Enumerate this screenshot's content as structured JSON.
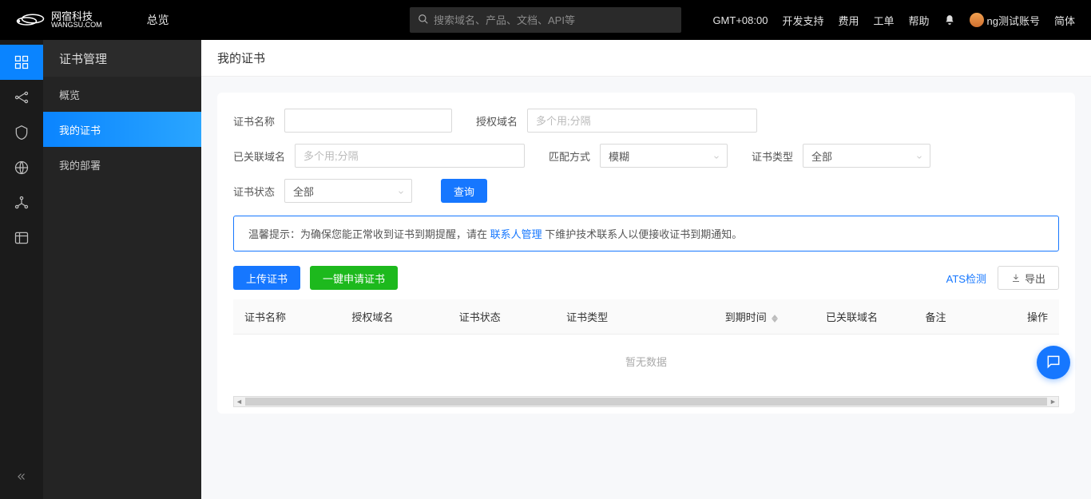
{
  "brand": {
    "cn": "网宿科技",
    "en": "WANGSU.COM"
  },
  "topbar": {
    "overview": "总览",
    "search_placeholder": "搜索域名、产品、文档、API等",
    "timezone": "GMT+08:00",
    "dev_support": "开发支持",
    "billing": "费用",
    "tickets": "工单",
    "help": "帮助",
    "account": "ng测试账号",
    "lang": "简体"
  },
  "sidebar": {
    "title": "证书管理",
    "items": [
      {
        "label": "概览"
      },
      {
        "label": "我的证书"
      },
      {
        "label": "我的部署"
      }
    ]
  },
  "page": {
    "title": "我的证书"
  },
  "filters": {
    "cert_name_label": "证书名称",
    "auth_domain_label": "授权域名",
    "auth_domain_placeholder": "多个用;分隔",
    "linked_domain_label": "已关联域名",
    "linked_domain_placeholder": "多个用;分隔",
    "match_mode_label": "匹配方式",
    "match_mode_value": "模糊",
    "cert_type_label": "证书类型",
    "cert_type_value": "全部",
    "cert_status_label": "证书状态",
    "cert_status_value": "全部",
    "query_btn": "查询"
  },
  "notice": {
    "prefix": "温馨提示：为确保您能正常收到证书到期提醒，请在 ",
    "link": "联系人管理",
    "suffix": " 下维护技术联系人以便接收证书到期通知。"
  },
  "actions": {
    "upload": "上传证书",
    "quick_apply": "一键申请证书",
    "ats": "ATS检测",
    "export": "导出"
  },
  "table": {
    "headers": {
      "cert_name": "证书名称",
      "auth_domain": "授权域名",
      "cert_status": "证书状态",
      "cert_type": "证书类型",
      "expire": "到期时间",
      "linked_domain": "已关联域名",
      "remark": "备注",
      "op": "操作"
    },
    "empty": "暂无数据"
  }
}
